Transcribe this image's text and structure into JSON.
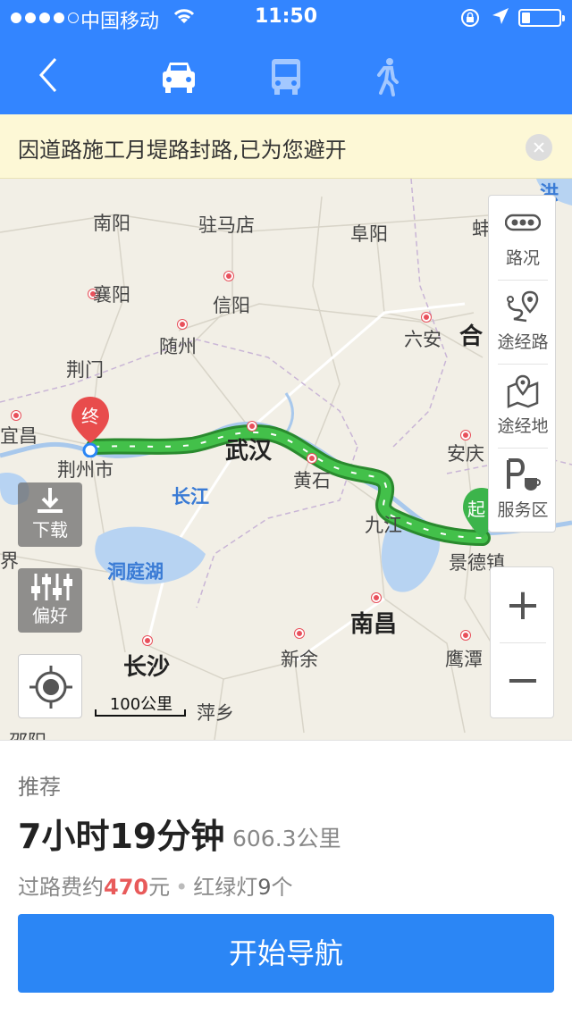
{
  "status_bar": {
    "carrier": "中国移动",
    "time": "11:50",
    "battery_level": 0.2
  },
  "nav": {
    "modes": [
      "car",
      "bus",
      "walk"
    ],
    "active_mode": "car"
  },
  "notice": {
    "text": "因道路施工月堤路封路,已为您避开"
  },
  "map": {
    "cities": [
      "南阳",
      "驻马店",
      "阜阳",
      "蚌",
      "洪",
      "襄阳",
      "信阳",
      "六安",
      "合",
      "随州",
      "荆门",
      "宜昌",
      "荆州市",
      "武汉",
      "黄石",
      "安庆",
      "长江",
      "九江",
      "景德镇",
      "界",
      "洞庭湖",
      "南昌",
      "长沙",
      "新余",
      "鹰潭",
      "萍乡",
      "邵阳"
    ],
    "end_marker": "终",
    "start_marker": "起",
    "scale_label": "100公里",
    "download_label": "下载",
    "preference_label": "偏好",
    "tools": {
      "traffic": "路况",
      "waypoint_route": "途经路",
      "waypoint_place": "途经地",
      "service_area": "服务区"
    },
    "zoom_in": "+",
    "zoom_out": "−"
  },
  "route": {
    "tag": "推荐",
    "duration": "7小时19分钟",
    "distance": "606.3公里",
    "toll_prefix": "过路费约",
    "toll_amount": "470",
    "toll_unit": "元",
    "lights_prefix": "红绿灯",
    "lights_count": "9",
    "lights_unit": "个",
    "start_button": "开始导航"
  },
  "colors": {
    "primary": "#3385ff",
    "route_green": "#3cb44b",
    "toll_red": "#e85a5a",
    "notice_bg": "#fdf8d6"
  }
}
